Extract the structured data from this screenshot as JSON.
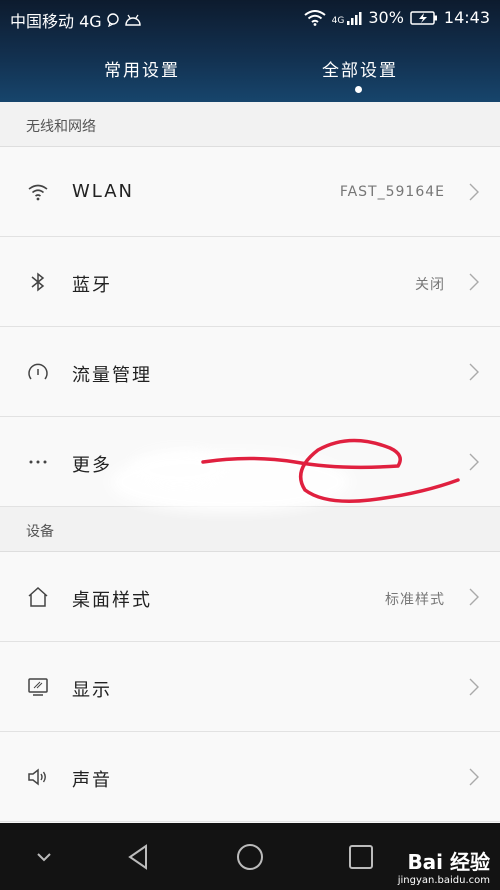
{
  "status_bar": {
    "carrier": "中国移动 4G",
    "network_type": "4G",
    "battery": "30%",
    "time": "14:43"
  },
  "tabs": [
    {
      "label": "常用设置",
      "active": false
    },
    {
      "label": "全部设置",
      "active": true
    }
  ],
  "sections": {
    "network": {
      "title": "无线和网络",
      "items": [
        {
          "label": "WLAN",
          "value": "FAST_59164E",
          "icon": "wifi-icon"
        },
        {
          "label": "蓝牙",
          "value": "关闭",
          "icon": "bluetooth-icon"
        },
        {
          "label": "流量管理",
          "value": "",
          "icon": "data-usage-icon"
        },
        {
          "label": "更多",
          "value": "",
          "icon": "more-dots-icon"
        }
      ]
    },
    "device": {
      "title": "设备",
      "items": [
        {
          "label": "桌面样式",
          "value": "标准样式",
          "icon": "home-icon"
        },
        {
          "label": "显示",
          "value": "",
          "icon": "display-icon"
        },
        {
          "label": "声音",
          "value": "",
          "icon": "speaker-icon"
        }
      ]
    }
  },
  "watermark": {
    "brand": "Bai 经验",
    "url": "jingyan.baidu.com"
  },
  "colors": {
    "header_top": "#0d1b2e",
    "header_bottom": "#17456c",
    "annotation": "#e0203f",
    "navbar": "#131313"
  }
}
